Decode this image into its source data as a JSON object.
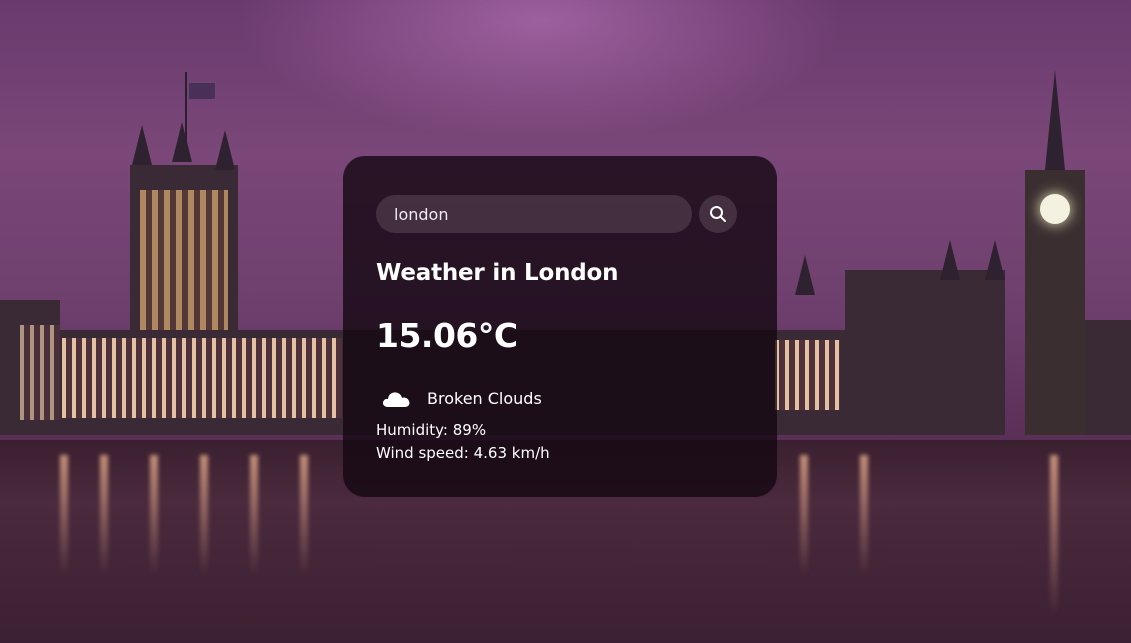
{
  "search": {
    "value": "london"
  },
  "weather": {
    "title": "Weather in London",
    "temperature": "15.06°C",
    "description": "Broken Clouds",
    "humidity": "Humidity: 89%",
    "wind": "Wind speed: 4.63 km/h"
  },
  "icons": {
    "search": "search-icon",
    "condition": "cloud-icon"
  },
  "colors": {
    "card_bg": "#140812",
    "text": "#ffffff",
    "input_bg": "#786473"
  }
}
